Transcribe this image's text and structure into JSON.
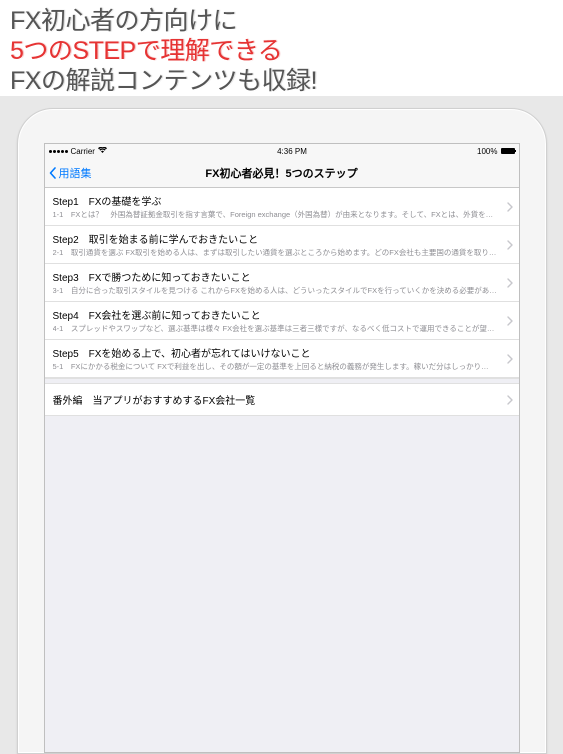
{
  "promo": {
    "line1": "FX初心者の方向けに",
    "line2": "5つのSTEPで理解できる",
    "line3": "FXの解説コンテンツも収録!"
  },
  "statusbar": {
    "carrier": "Carrier",
    "wifi_icon": "wifi",
    "time": "4:36 PM",
    "battery_pct": "100%"
  },
  "navbar": {
    "back_label": "用語集",
    "title": "FX初心者必見！5つのステップ"
  },
  "list": {
    "items": [
      {
        "title": "Step1　FXの基礎を学ぶ",
        "subtitle": "1-1　FXとは？　外国為替証拠金取引を指す言葉で、Foreign exchange（外国為替）が由来となります。そして、FXとは、外貨を…"
      },
      {
        "title": "Step2　取引を始まる前に学んでおきたいこと",
        "subtitle": "2-1　取引通貨を選ぶ FX取引を始める人は、まずは取引したい通貨を選ぶところから始めます。どのFX会社も主要国の通貨を取り…"
      },
      {
        "title": "Step3　FXで勝つために知っておきたいこと",
        "subtitle": "3-1　自分に合った取引スタイルを見つける これからFXを始める人は、どういったスタイルでFXを行っていくかを決める必要があ…"
      },
      {
        "title": "Step4　FX会社を選ぶ前に知っておきたいこと",
        "subtitle": "4-1　スプレッドやスワップなど、選ぶ基準は様々 FX会社を選ぶ基準は三者三様ですが、なるべく低コストで運用できることが望…"
      },
      {
        "title": "Step5　FXを始める上で、初心者が忘れてはいけないこと",
        "subtitle": "5-1　FXにかかる税金について FXで利益を出し、その額が一定の基準を上回ると納税の義務が発生します。稼いだ分はしっかり…"
      }
    ],
    "extra": {
      "title": "番外編　当アプリがおすすめするFX会社一覧"
    }
  }
}
